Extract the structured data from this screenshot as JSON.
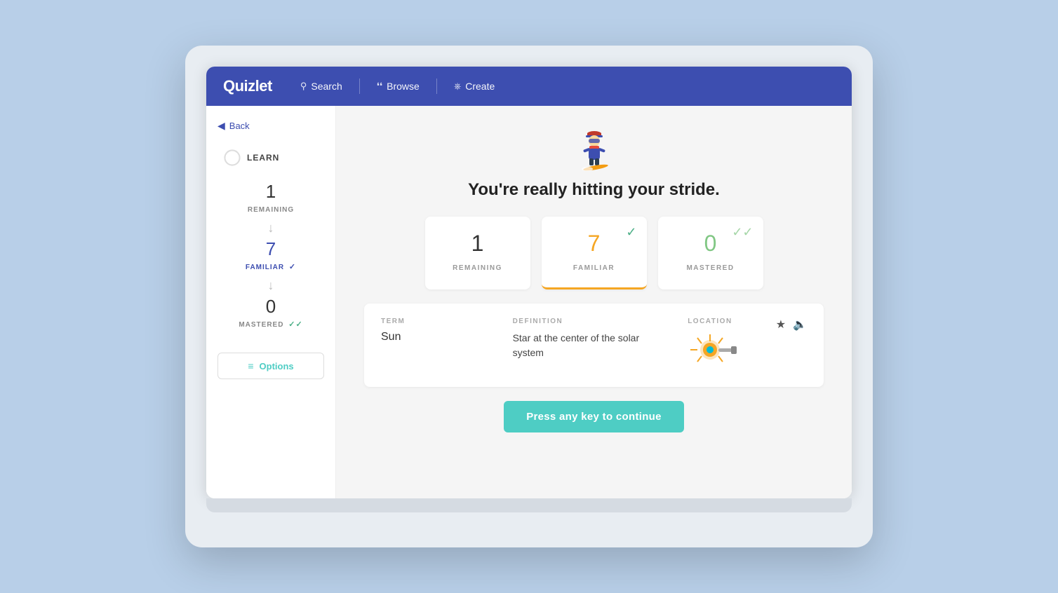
{
  "nav": {
    "logo": "Quizlet",
    "search_label": "Search",
    "browse_label": "Browse",
    "create_label": "Create"
  },
  "sidebar": {
    "back_label": "Back",
    "learn_label": "LEARN",
    "remaining_number": "1",
    "remaining_label": "REMAINING",
    "familiar_number": "7",
    "familiar_label": "FAMILIAR",
    "mastered_number": "0",
    "mastered_label": "MASTERED",
    "options_label": "Options"
  },
  "main": {
    "title": "You're really hitting your stride.",
    "cards": [
      {
        "number": "1",
        "label": "REMAINING",
        "type": "remaining"
      },
      {
        "number": "7",
        "label": "FAMILIAR",
        "type": "familiar"
      },
      {
        "number": "0",
        "label": "MASTERED",
        "type": "mastered"
      }
    ],
    "flashcard": {
      "term_label": "TERM",
      "term_value": "Sun",
      "definition_label": "DEFINITION",
      "definition_value": "Star at the center of the solar system",
      "location_label": "LOCATION"
    },
    "continue_label": "Press any key to continue"
  }
}
